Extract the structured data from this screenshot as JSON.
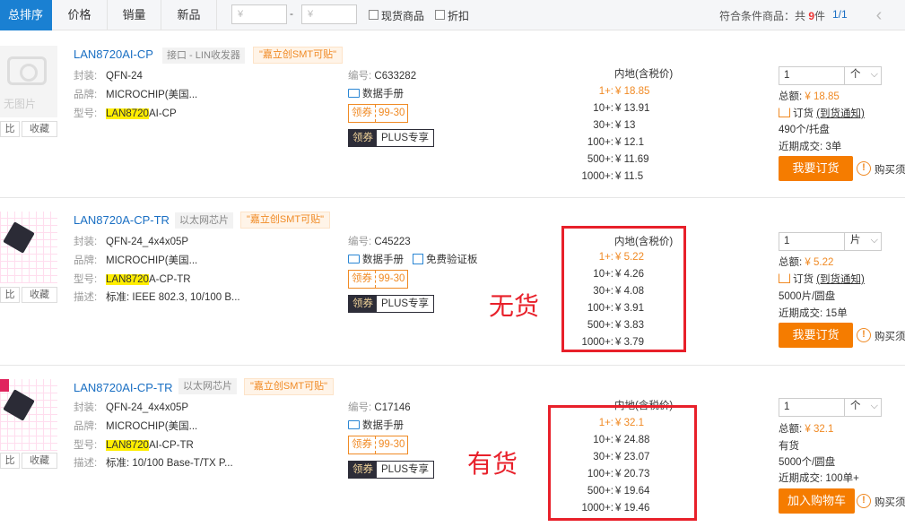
{
  "filter_bar": {
    "sort_active": "总排序",
    "sort_tabs": [
      "价格",
      "销量",
      "新品"
    ],
    "price_min_placeholder": "¥",
    "price_max_placeholder": "¥",
    "dash": "-",
    "in_stock_label": "现货商品",
    "discount_label": "折扣",
    "result_prefix": "符合条件商品：共",
    "result_count": "9",
    "result_suffix": "件",
    "page": "1/1",
    "prev_icon": "‹"
  },
  "thumb": {
    "no_image": "无图片",
    "compare": "比",
    "favorite": "收藏"
  },
  "labels": {
    "package": "封装:",
    "brand": "品牌:",
    "model": "型号:",
    "desc": "描述:",
    "code": "编号:",
    "datasheet": "数据手册",
    "eval_board": "免费验证板",
    "coupon_a": "领券",
    "coupon_b": "99-30",
    "plus_a": "领券",
    "plus_b": "PLUS专享",
    "price_head": "内地(含税价)",
    "total": "总额:",
    "order": "订货",
    "order_link": "(到货通知)",
    "recent": "近期成交:",
    "must_read": "购买须"
  },
  "products": [
    {
      "title": "LAN8720AI-CP",
      "category": "接口 - LIN收发器",
      "smt": "\"嘉立创SMT可贴\"",
      "package": "QFN-24",
      "brand": "MICROCHIP(美国...",
      "model_hl": "LAN8720",
      "model_rest": "AI-CP",
      "code": "C633282",
      "prices": [
        {
          "qty": "1+:",
          "price": "¥ 18.85"
        },
        {
          "qty": "10+:",
          "price": "¥ 13.91"
        },
        {
          "qty": "30+:",
          "price": "¥ 13"
        },
        {
          "qty": "100+:",
          "price": "¥ 12.1"
        },
        {
          "qty": "500+:",
          "price": "¥ 11.69"
        },
        {
          "qty": "1000+:",
          "price": "¥ 11.5"
        }
      ],
      "qty": "1",
      "unit": "个",
      "total": "¥ 18.85",
      "stock_line": "490个/托盘",
      "recent": "3单",
      "button": "我要订货"
    },
    {
      "title": "LAN8720A-CP-TR",
      "category": "以太网芯片",
      "smt": "\"嘉立创SMT可贴\"",
      "package": "QFN-24_4x4x05P",
      "brand": "MICROCHIP(美国...",
      "model_hl": "LAN8720",
      "model_rest": "A-CP-TR",
      "desc": "标准: IEEE 802.3, 10/100 B...",
      "code": "C45223",
      "prices": [
        {
          "qty": "1+:",
          "price": "¥ 5.22"
        },
        {
          "qty": "10+:",
          "price": "¥ 4.26"
        },
        {
          "qty": "30+:",
          "price": "¥ 4.08"
        },
        {
          "qty": "100+:",
          "price": "¥ 3.91"
        },
        {
          "qty": "500+:",
          "price": "¥ 3.83"
        },
        {
          "qty": "1000+:",
          "price": "¥ 3.79"
        }
      ],
      "qty": "1",
      "unit": "片",
      "total": "¥ 5.22",
      "stock_line": "5000片/圆盘",
      "recent": "15单",
      "button": "我要订货",
      "annotation": "无货"
    },
    {
      "title": "LAN8720AI-CP-TR",
      "category": "以太网芯片",
      "smt": "\"嘉立创SMT可贴\"",
      "package": "QFN-24_4x4x05P",
      "brand": "MICROCHIP(美国...",
      "model_hl": "LAN8720",
      "model_rest": "AI-CP-TR",
      "desc": "标准: 10/100 Base-T/TX P...",
      "code": "C17146",
      "prices": [
        {
          "qty": "1+:",
          "price": "¥ 32.1"
        },
        {
          "qty": "10+:",
          "price": "¥ 24.88"
        },
        {
          "qty": "30+:",
          "price": "¥ 23.07"
        },
        {
          "qty": "100+:",
          "price": "¥ 20.73"
        },
        {
          "qty": "500+:",
          "price": "¥ 19.64"
        },
        {
          "qty": "1000+:",
          "price": "¥ 19.46"
        }
      ],
      "qty": "1",
      "unit": "个",
      "total": "¥ 32.1",
      "in_stock": "有货",
      "stock_line": "5000个/圆盘",
      "recent": "100单+",
      "button": "加入购物车",
      "annotation": "有货"
    }
  ],
  "colors": {
    "accent": "#1a80d2",
    "orange": "#f57c00",
    "annotation_red": "#e8202a"
  }
}
